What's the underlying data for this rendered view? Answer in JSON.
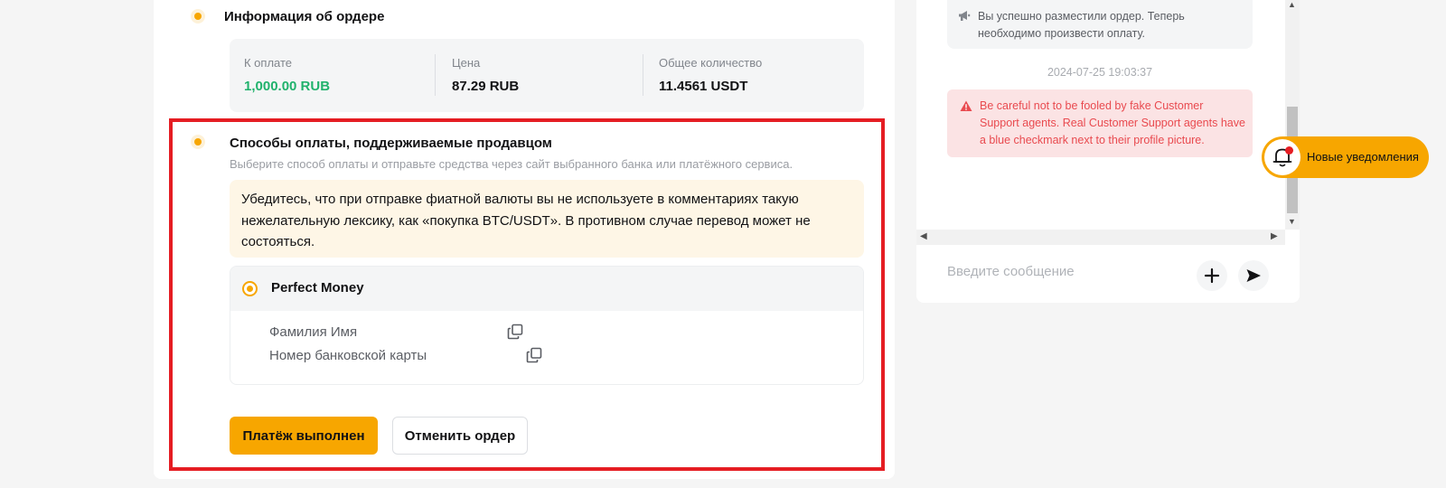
{
  "order_info": {
    "title": "Информация об ордере",
    "columns": [
      {
        "label": "К оплате",
        "value": "1,000.00 RUB"
      },
      {
        "label": "Цена",
        "value": "87.29 RUB"
      },
      {
        "label": "Общее количество",
        "value": "11.4561 USDT"
      }
    ]
  },
  "payment_methods": {
    "title": "Способы оплаты, поддерживаемые продавцом",
    "description": "Выберите способ оплаты и отправьте средства через сайт выбранного банка или платёжного сервиса.",
    "warning": "Убедитесь, что при отправке фиатной валюты вы не используете в комментариях такую нежелательную лексику, как «покупка BTC/USDT». В противном случае перевод может не состояться.",
    "method": {
      "name": "Perfect Money",
      "selected": true,
      "fields": [
        "Фамилия Имя",
        "Номер банковской карты"
      ]
    }
  },
  "actions": {
    "payment_done": "Платёж выполнен",
    "cancel_order": "Отменить ордер"
  },
  "chat": {
    "system_message": "Вы успешно разместили ордер. Теперь необходимо произвести оплату.",
    "timestamp": "2024-07-25 19:03:37",
    "alert_message": "Be careful not to be fooled by fake Customer Support agents. Real Customer Support agents have a blue checkmark next to their profile picture.",
    "input_placeholder": "Введите сообщение"
  },
  "notification": {
    "label": "Новые уведомления"
  },
  "colors": {
    "accent": "#f7a600",
    "amount_green": "#20b26c",
    "highlight_red": "#e51d23",
    "alert_text": "#e94a4f"
  },
  "icons": [
    "megaphone-icon",
    "warning-icon",
    "copy-icon",
    "plus-icon",
    "send-icon",
    "bell-icon"
  ]
}
